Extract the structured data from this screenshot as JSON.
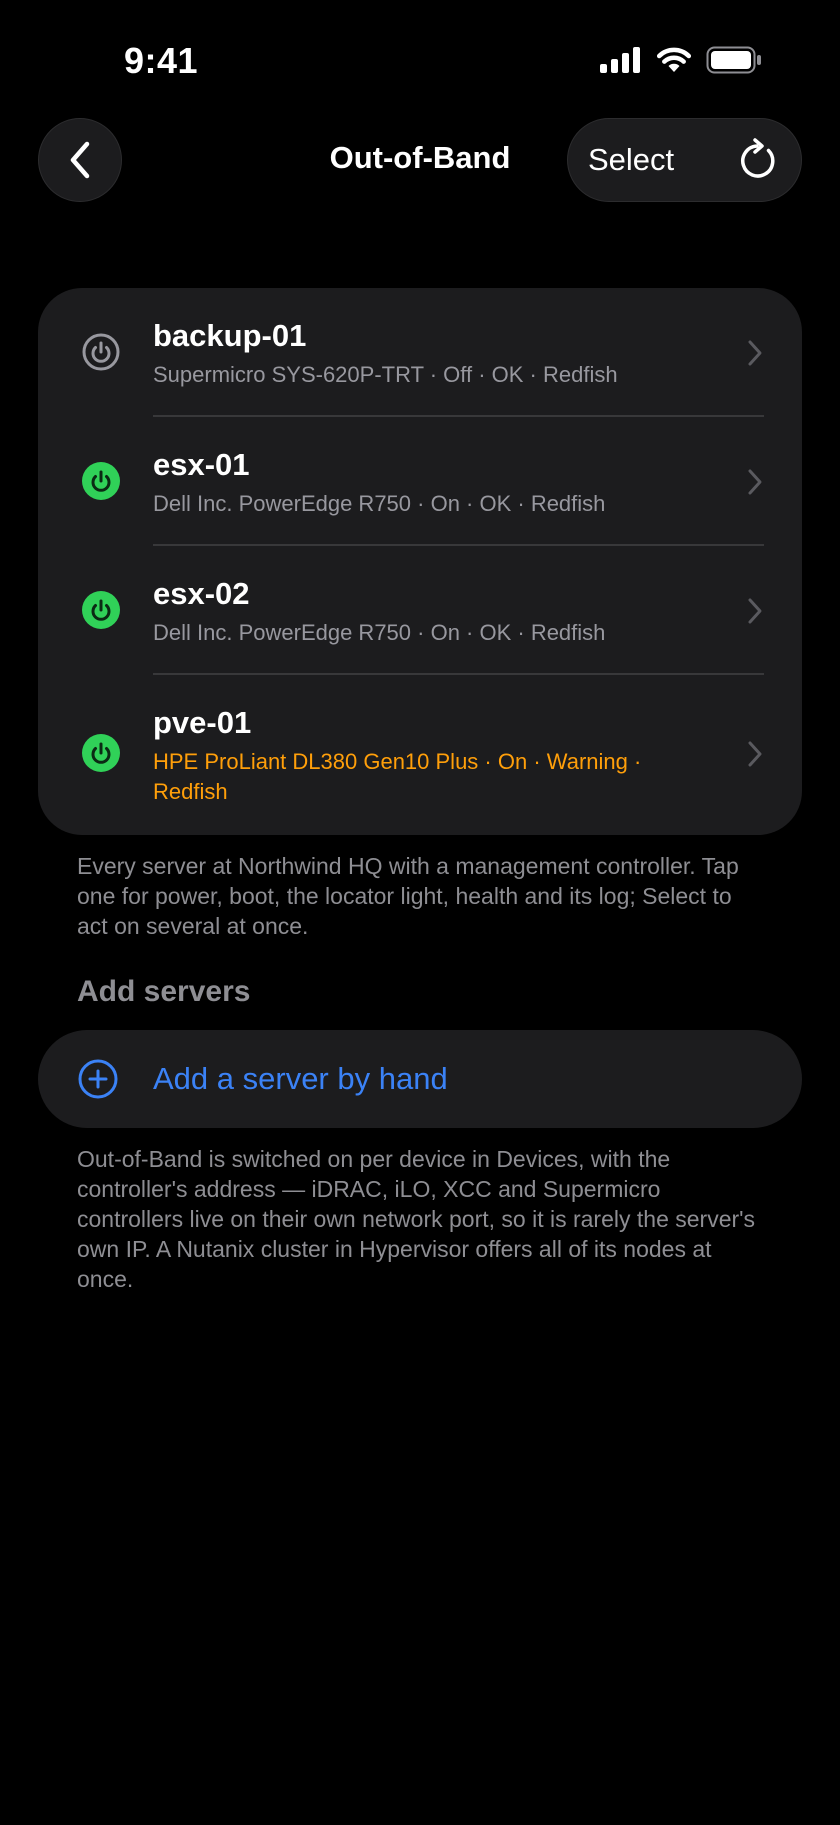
{
  "status_bar": {
    "time": "9:41"
  },
  "nav": {
    "back_icon": "chevron-left-icon",
    "title": "Out-of-Band",
    "select_label": "Select",
    "refresh_icon": "refresh-icon"
  },
  "servers": [
    {
      "name": "backup-01",
      "detail": "Supermicro SYS-620P-TRT · Off · OK · Redfish",
      "power": "off",
      "status_color": "#98989f"
    },
    {
      "name": "esx-01",
      "detail": "Dell Inc. PowerEdge R750 · On · OK · Redfish",
      "power": "on",
      "status_color": "#30d158"
    },
    {
      "name": "esx-02",
      "detail": "Dell Inc. PowerEdge R750 · On · OK · Redfish",
      "power": "on",
      "status_color": "#30d158"
    },
    {
      "name": "pve-01",
      "detail": "HPE ProLiant DL380 Gen10 Plus · On · Warning · Redfish",
      "power": "on",
      "status_color": "#30d158",
      "warning": true
    }
  ],
  "servers_footnote": "Every server at Northwind HQ with a management controller. Tap one for power, boot, the locator light, health and its log; Select to act on several at once.",
  "add_section": {
    "header": "Add servers",
    "add_label": "Add a server by hand",
    "add_icon": "plus-circle-icon"
  },
  "add_footnote": "Out-of-Band is switched on per device in Devices, with the controller's address — iDRAC, iLO, XCC and Supermicro controllers live on their own network port, so it is rarely the server's own IP. A Nutanix cluster in Hypervisor offers all of its nodes at once.",
  "colors": {
    "accent": "#3b82f6",
    "on": "#30d158",
    "warning": "#ff9f0a",
    "card": "#1c1c1e"
  }
}
